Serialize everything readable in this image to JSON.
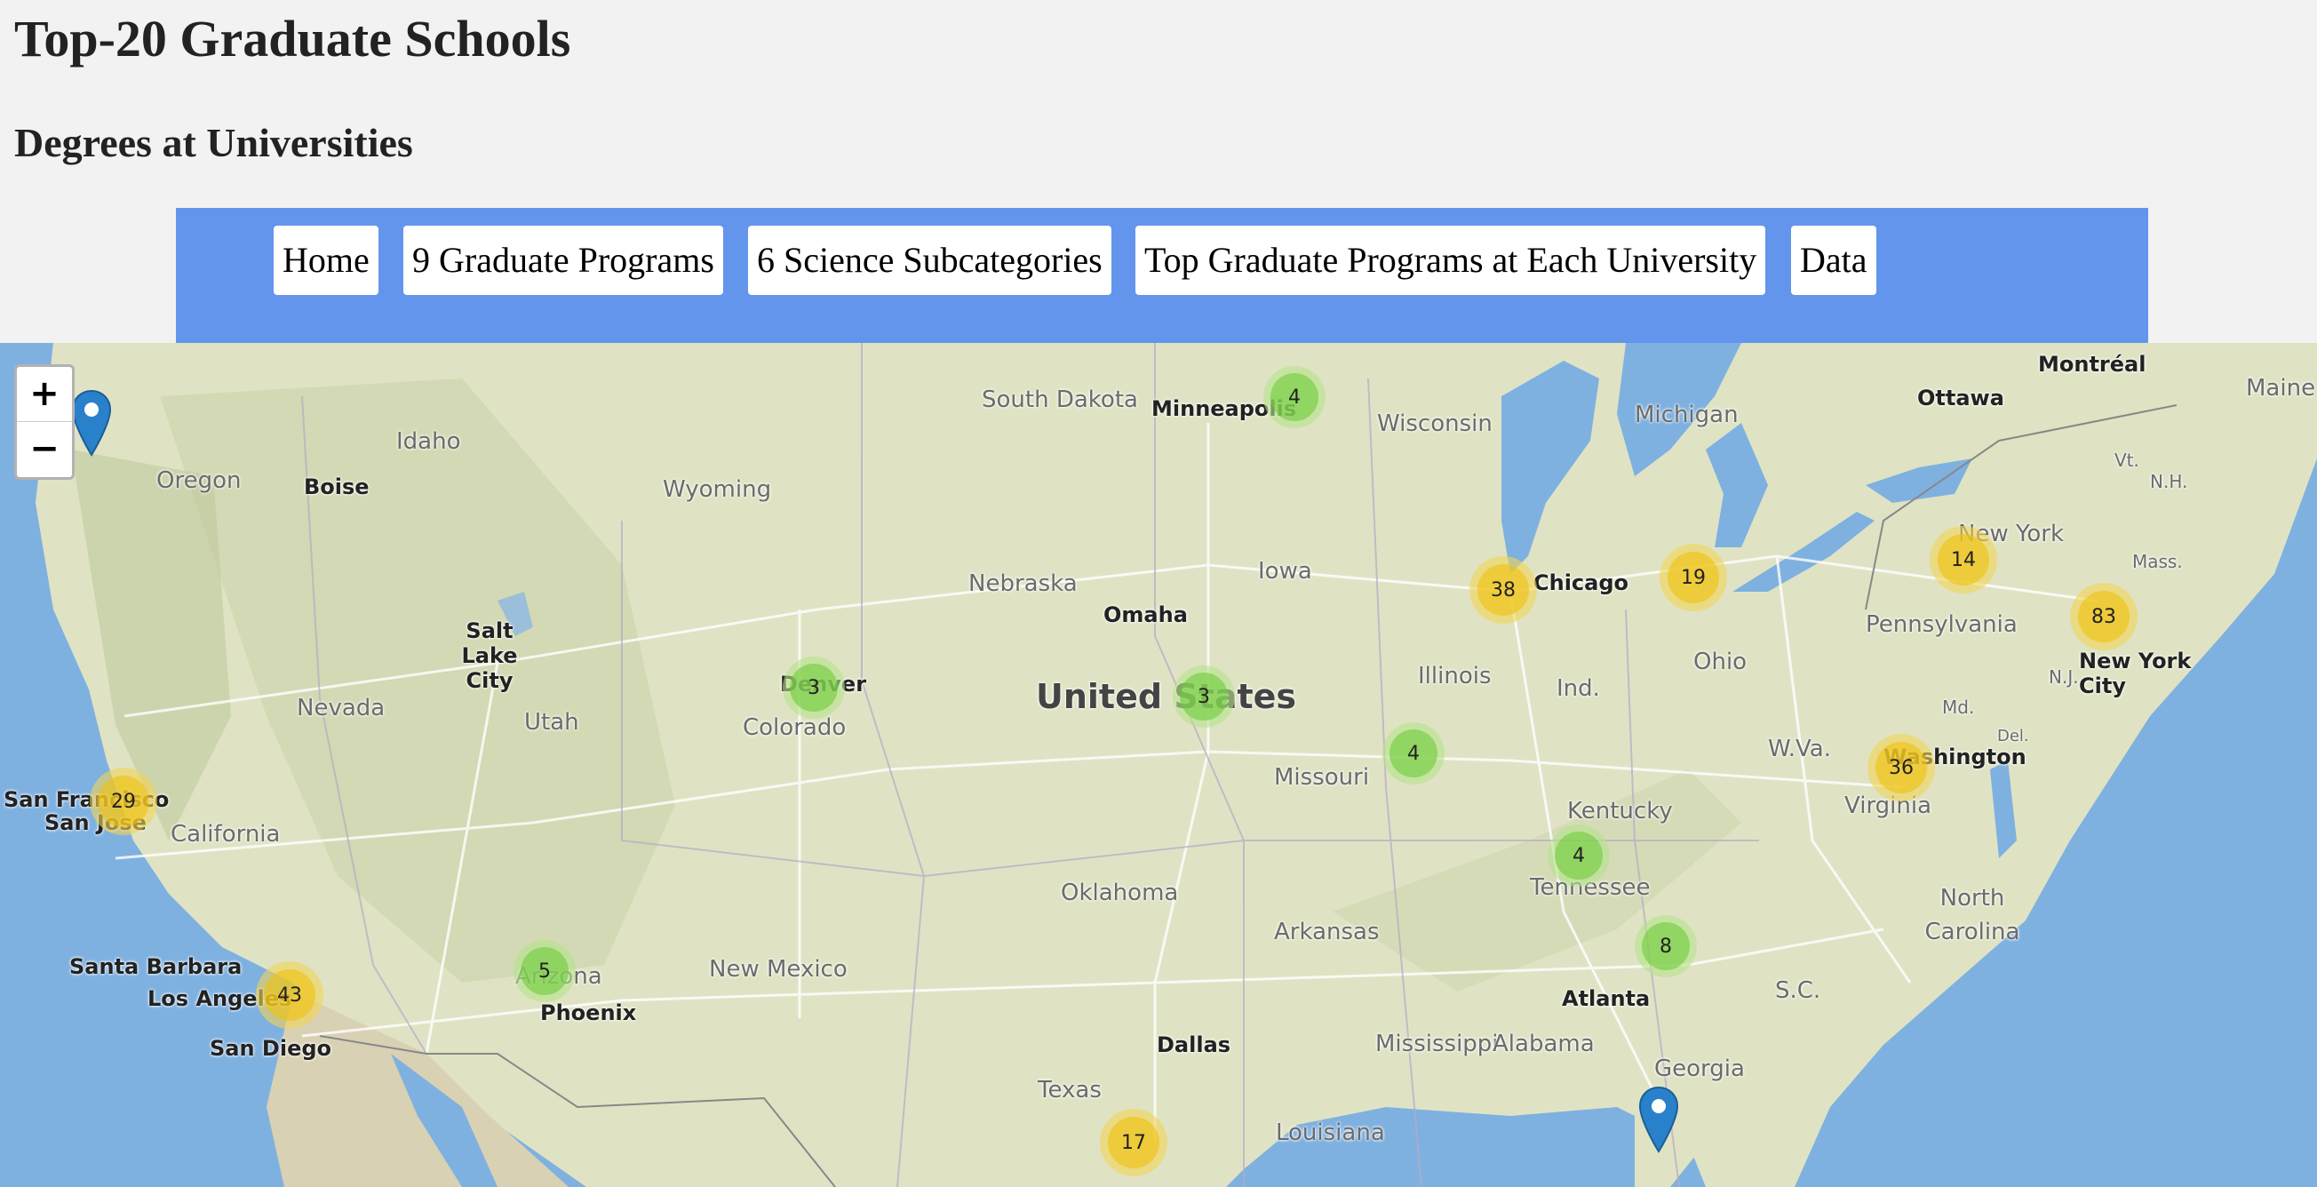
{
  "page": {
    "title": "Top-20 Graduate Schools",
    "subtitle": "Degrees at Universities"
  },
  "nav": {
    "items": [
      {
        "label": "Home"
      },
      {
        "label": "9 Graduate Programs"
      },
      {
        "label": "6 Science Subcategories"
      },
      {
        "label": "Top Graduate Programs at Each University"
      },
      {
        "label": "Data"
      }
    ]
  },
  "map": {
    "zoom_in": "+",
    "zoom_out": "−",
    "clusters": [
      {
        "count": "4",
        "size": "small"
      },
      {
        "count": "38",
        "size": "medium"
      },
      {
        "count": "19",
        "size": "medium"
      },
      {
        "count": "14",
        "size": "medium"
      },
      {
        "count": "83",
        "size": "medium"
      },
      {
        "count": "3",
        "size": "small"
      },
      {
        "count": "3",
        "size": "small"
      },
      {
        "count": "4",
        "size": "small"
      },
      {
        "count": "29",
        "size": "medium"
      },
      {
        "count": "36",
        "size": "medium"
      },
      {
        "count": "4",
        "size": "small"
      },
      {
        "count": "43",
        "size": "medium"
      },
      {
        "count": "5",
        "size": "small"
      },
      {
        "count": "8",
        "size": "small"
      },
      {
        "count": "17",
        "size": "medium"
      }
    ],
    "labels": {
      "country": "United States",
      "states": [
        "South Dakota",
        "Wisconsin",
        "Michigan",
        "Idaho",
        "Oregon",
        "Wyoming",
        "Nebraska",
        "Iowa",
        "Nevada",
        "Utah",
        "Colorado",
        "Illinois",
        "Ind.",
        "Ohio",
        "Pennsylvania",
        "New York",
        "Missouri",
        "Kentucky",
        "California",
        "W.Va.",
        "Virginia",
        "Tennessee",
        "Oklahoma",
        "Arkansas",
        "North Carolina",
        "Arizona",
        "New Mexico",
        "Mississippi",
        "Alabama",
        "Georgia",
        "S.C.",
        "Texas",
        "Louisiana",
        "Maine",
        "Vt.",
        "N.H.",
        "Mass.",
        "N.J.",
        "Md.",
        "Del."
      ],
      "cities": [
        "Minneapolis",
        "Ottawa",
        "Montréal",
        "Boise",
        "Salt Lake City",
        "Omaha",
        "Chicago",
        "Denver",
        "New York City",
        "Washington",
        "San Francisco",
        "San Jose",
        "Santa Barbara",
        "Los Angeles",
        "San Diego",
        "Phoenix",
        "Dallas",
        "Atlanta"
      ]
    }
  },
  "colors": {
    "navbar": "#6495ed",
    "background": "#f2f2f2",
    "water": "#7fb1e0",
    "land": "#dfe3c4",
    "cluster_small": "#6ecc39",
    "cluster_medium": "#f0c20c",
    "marker": "#2a81cb"
  }
}
